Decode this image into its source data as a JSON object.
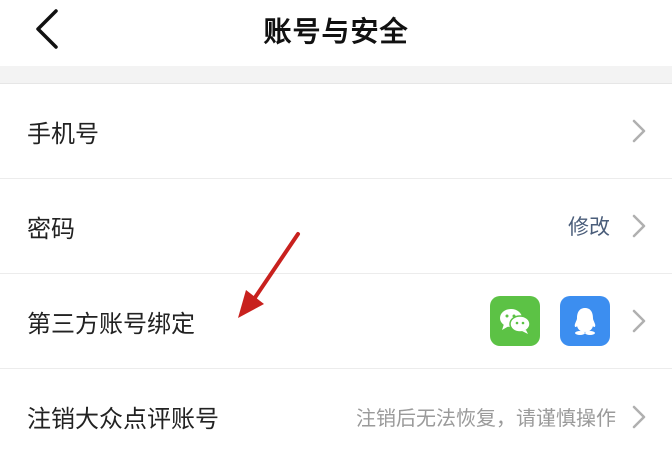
{
  "header": {
    "title": "账号与安全",
    "back_icon": "chevron-left-icon"
  },
  "rows": [
    {
      "label": "手机号",
      "value": "",
      "icon": "chevron-right-icon"
    },
    {
      "label": "密码",
      "value": "修改",
      "icon": "chevron-right-icon"
    },
    {
      "label": "第三方账号绑定",
      "badges": [
        "wechat-icon",
        "qq-icon"
      ],
      "icon": "chevron-right-icon"
    },
    {
      "label": "注销大众点评账号",
      "hint": "注销后无法恢复，请谨慎操作",
      "icon": "chevron-right-icon"
    }
  ],
  "colors": {
    "wechat": "#5cc245",
    "qq": "#3c8ef0",
    "annotation_arrow": "#c8211e",
    "link_value": "#4a5d7a"
  }
}
